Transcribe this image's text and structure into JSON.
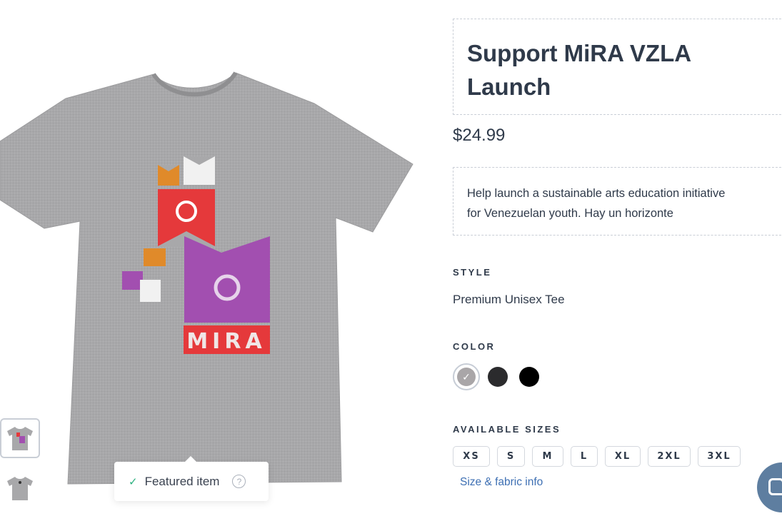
{
  "product": {
    "title_line1": "Support MiRA VZLA",
    "title_line2": "Launch",
    "price": "$24.99",
    "description_line1": "Help launch a sustainable arts education initiative",
    "description_line2": "for Venezuelan youth. Hay un horizonte",
    "design_text": "MIRA"
  },
  "style": {
    "label": "STYLE",
    "value": "Premium Unisex Tee"
  },
  "color": {
    "label": "COLOR",
    "swatches": [
      {
        "name": "heather-grey",
        "hex": "#a9a6a8",
        "selected": true
      },
      {
        "name": "charcoal",
        "hex": "#2b2b2d",
        "selected": false
      },
      {
        "name": "black",
        "hex": "#000000",
        "selected": false
      }
    ]
  },
  "sizes": {
    "label": "AVAILABLE SIZES",
    "options": [
      "XS",
      "S",
      "M",
      "L",
      "XL",
      "2XL",
      "3XL"
    ],
    "info_link": "Size & fabric info"
  },
  "featured": {
    "label": "Featured item",
    "help_glyph": "?"
  },
  "colors": {
    "shirt": "#a7a7a9",
    "accent_red": "#e5393b",
    "accent_purple": "#a24fb0",
    "accent_orange": "#e08a2a",
    "link": "#3d6fb3"
  }
}
